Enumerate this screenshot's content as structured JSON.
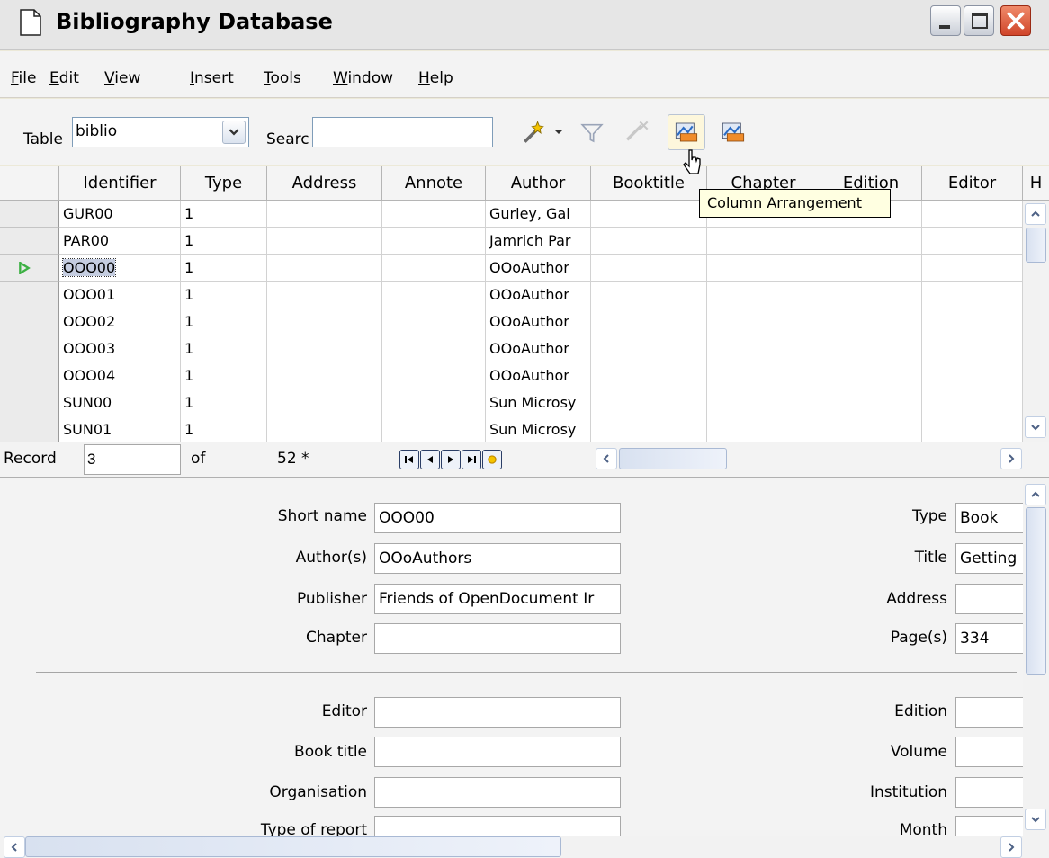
{
  "window": {
    "title": "Bibliography Database"
  },
  "menu": [
    "File",
    "Edit",
    "View",
    "Insert",
    "Tools",
    "Window",
    "Help"
  ],
  "menu_mnemonics": [
    "F",
    "E",
    "V",
    "I",
    "T",
    "W",
    "H"
  ],
  "toolbar": {
    "table_label": "Table",
    "table_value": "biblio",
    "search_label": "Searc",
    "search_value": "",
    "tooltip": "Column Arrangement",
    "icons": [
      "autofilter-wand-icon",
      "dropdown-arrow-icon",
      "standard-filter-icon",
      "remove-filter-icon",
      "column-arrangement-icon",
      "data-source-icon"
    ]
  },
  "grid": {
    "columns": [
      "Identifier",
      "Type",
      "Address",
      "Annote",
      "Author",
      "Booktitle",
      "Chapter",
      "Edition",
      "Editor",
      "H"
    ],
    "rows": [
      {
        "identifier": "GUR00",
        "type": "1",
        "author": "Gurley, Gal"
      },
      {
        "identifier": "PAR00",
        "type": "1",
        "author": "Jamrich Par"
      },
      {
        "identifier": "OOO00",
        "type": "1",
        "author": "OOoAuthor",
        "current": true
      },
      {
        "identifier": "OOO01",
        "type": "1",
        "author": "OOoAuthor"
      },
      {
        "identifier": "OOO02",
        "type": "1",
        "author": "OOoAuthor"
      },
      {
        "identifier": "OOO03",
        "type": "1",
        "author": "OOoAuthor"
      },
      {
        "identifier": "OOO04",
        "type": "1",
        "author": "OOoAuthor"
      },
      {
        "identifier": "SUN00",
        "type": "1",
        "author": "Sun Microsy"
      },
      {
        "identifier": "SUN01",
        "type": "1",
        "author": "Sun Microsy"
      }
    ]
  },
  "record_bar": {
    "label": "Record",
    "current": "3",
    "of_label": "of",
    "total": "52 *"
  },
  "form": {
    "left": [
      {
        "label": "Short name",
        "value": "OOO00"
      },
      {
        "label": "Author(s)",
        "value": "OOoAuthors"
      },
      {
        "label": "Publisher",
        "value": "Friends of OpenDocument Ir"
      },
      {
        "label": "Chapter",
        "value": ""
      },
      {
        "label": "Editor",
        "value": ""
      },
      {
        "label": "Book title",
        "value": ""
      },
      {
        "label": "Organisation",
        "value": ""
      },
      {
        "label": "Type of report",
        "value": ""
      }
    ],
    "right": [
      {
        "label": "Type",
        "value": "Book"
      },
      {
        "label": "Title",
        "value": "Getting"
      },
      {
        "label": "Address",
        "value": ""
      },
      {
        "label": "Page(s)",
        "value": "334"
      },
      {
        "label": "Edition",
        "value": ""
      },
      {
        "label": "Volume",
        "value": ""
      },
      {
        "label": "Institution",
        "value": ""
      },
      {
        "label": "Month",
        "value": ""
      }
    ]
  },
  "colors": {
    "close_button": "#d0452a",
    "tooltip_bg": "#ffffe1",
    "record_pointer": "#3cb043"
  }
}
